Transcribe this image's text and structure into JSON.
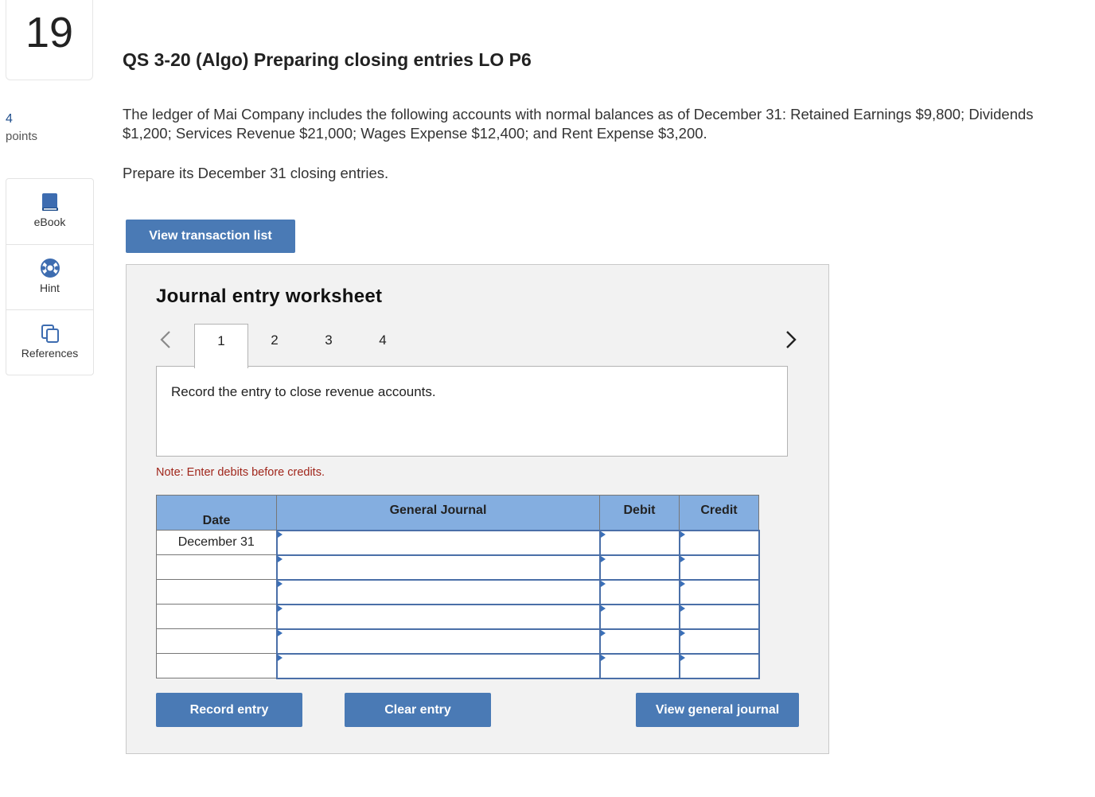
{
  "question": {
    "number": "19",
    "points_value": "4",
    "points_label": "points",
    "title": "QS 3-20 (Algo) Preparing closing entries LO P6",
    "text": "The ledger of Mai Company includes the following accounts with normal balances as of December 31: Retained Earnings $9,800; Dividends $1,200; Services Revenue $21,000; Wages Expense $12,400; and Rent Expense $3,200.",
    "instruction": "Prepare its December 31 closing entries."
  },
  "tools": [
    {
      "label": "eBook",
      "icon": "book-icon"
    },
    {
      "label": "Hint",
      "icon": "lifebuoy-icon"
    },
    {
      "label": "References",
      "icon": "copy-icon"
    }
  ],
  "buttons": {
    "view_transaction_list": "View transaction list",
    "record_entry": "Record entry",
    "clear_entry": "Clear entry",
    "view_general_journal": "View general journal"
  },
  "worksheet": {
    "title": "Journal entry worksheet",
    "tabs": [
      "1",
      "2",
      "3",
      "4"
    ],
    "active_tab": "1",
    "entry_instruction": "Record the entry to close revenue accounts.",
    "note": "Note: Enter debits before credits.",
    "columns": {
      "date": "Date",
      "account": "General Journal",
      "debit": "Debit",
      "credit": "Credit"
    },
    "rows": [
      {
        "date": "December 31",
        "account": "",
        "debit": "",
        "credit": ""
      },
      {
        "date": "",
        "account": "",
        "debit": "",
        "credit": ""
      },
      {
        "date": "",
        "account": "",
        "debit": "",
        "credit": ""
      },
      {
        "date": "",
        "account": "",
        "debit": "",
        "credit": ""
      },
      {
        "date": "",
        "account": "",
        "debit": "",
        "credit": ""
      },
      {
        "date": "",
        "account": "",
        "debit": "",
        "credit": ""
      }
    ]
  },
  "colors": {
    "accent": "#4a7ab5",
    "header_blue": "#84aee0",
    "note_red": "#a0261b"
  }
}
